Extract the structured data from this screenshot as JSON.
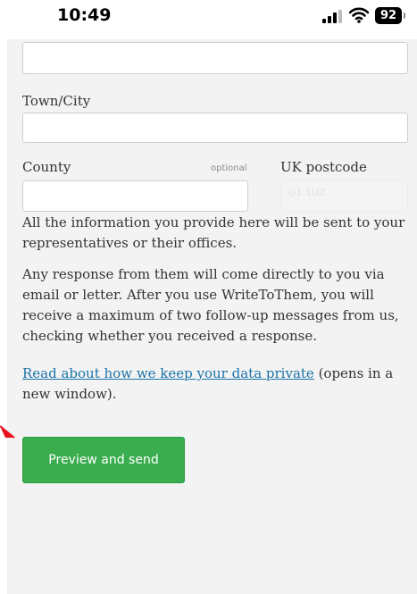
{
  "status_bar": {
    "time": "10:49",
    "battery_level": "92",
    "icons": [
      "signal-icon",
      "wifi-icon",
      "battery-icon"
    ]
  },
  "form": {
    "address_line_value": "",
    "town_label": "Town/City",
    "town_value": "",
    "county_label": "County",
    "county_optional": "optional",
    "county_value": "",
    "postcode_label": "UK postcode",
    "postcode_placeholder": "G1 1UZ"
  },
  "info": {
    "paragraph_1": "All the information you provide here will be sent to your representatives or their offices.",
    "paragraph_2": "Any response from them will come directly to you via email or letter. After you use WriteToThem, you will receive a maximum of two follow-up messages from us, checking whether you received a response.",
    "privacy_link": "Read about how we keep your data private",
    "privacy_suffix": " (opens in a new window)."
  },
  "actions": {
    "send_label": "Preview and send"
  },
  "colors": {
    "button": "#3aae4e",
    "link": "#1a73a8",
    "panel": "#f3f3f3",
    "annotation_arrow": "#e8141d"
  }
}
